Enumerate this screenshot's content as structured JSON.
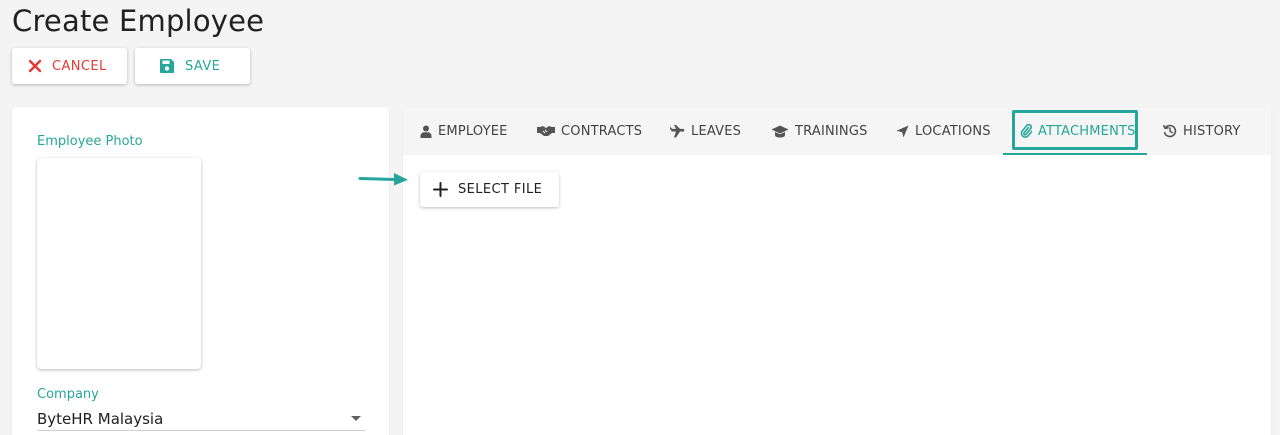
{
  "page": {
    "title": "Create Employee"
  },
  "toolbar": {
    "cancel_label": "CANCEL",
    "save_label": "SAVE"
  },
  "left_panel": {
    "photo_label": "Employee Photo",
    "company_label": "Company",
    "company_value": "ByteHR Malaysia"
  },
  "tabs": [
    {
      "label": "EMPLOYEE",
      "icon": "user-icon"
    },
    {
      "label": "CONTRACTS",
      "icon": "handshake-icon"
    },
    {
      "label": "LEAVES",
      "icon": "plane-icon"
    },
    {
      "label": "TRAININGS",
      "icon": "graduation-cap-icon"
    },
    {
      "label": "LOCATIONS",
      "icon": "location-arrow-icon"
    },
    {
      "label": "ATTACHMENTS",
      "icon": "paperclip-icon",
      "active": true
    },
    {
      "label": "HISTORY",
      "icon": "history-icon"
    }
  ],
  "attachments": {
    "select_file_label": "SELECT FILE"
  },
  "colors": {
    "accent": "#26a69a",
    "danger": "#e53935",
    "text": "#212121",
    "tab_bar": "#f5f5f5"
  }
}
